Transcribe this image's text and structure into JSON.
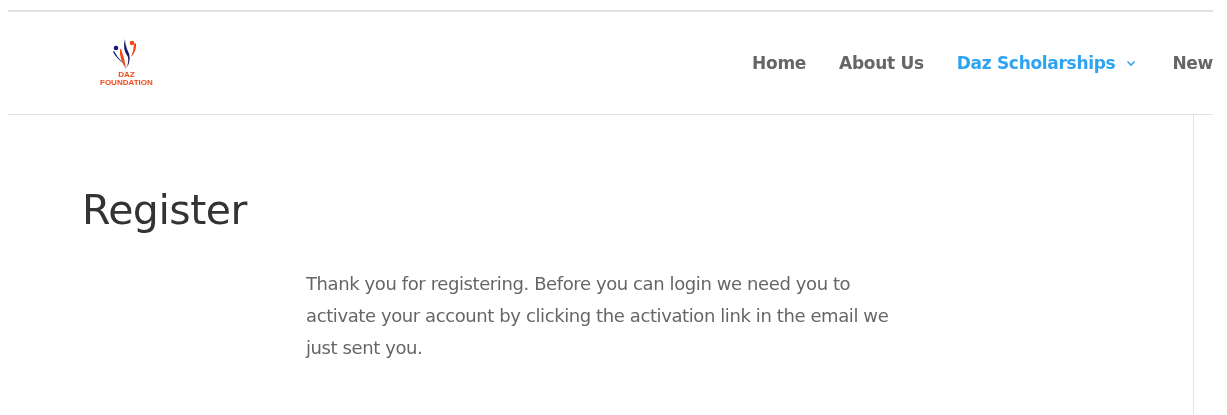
{
  "logo": {
    "line_1": "DAZ",
    "line_2": "FOUNDATION"
  },
  "nav": [
    {
      "label": "Home",
      "selected": false,
      "has_dropdown": false
    },
    {
      "label": "About Us",
      "selected": false,
      "has_dropdown": false
    },
    {
      "label": "Daz Scholarships",
      "selected": true,
      "has_dropdown": true
    },
    {
      "label": "New",
      "selected": false,
      "has_dropdown": false
    }
  ],
  "page": {
    "title": "Register",
    "message": "Thank you for registering. Before you can login we need you to activate your account by clicking the activation link in the email we just sent you."
  }
}
